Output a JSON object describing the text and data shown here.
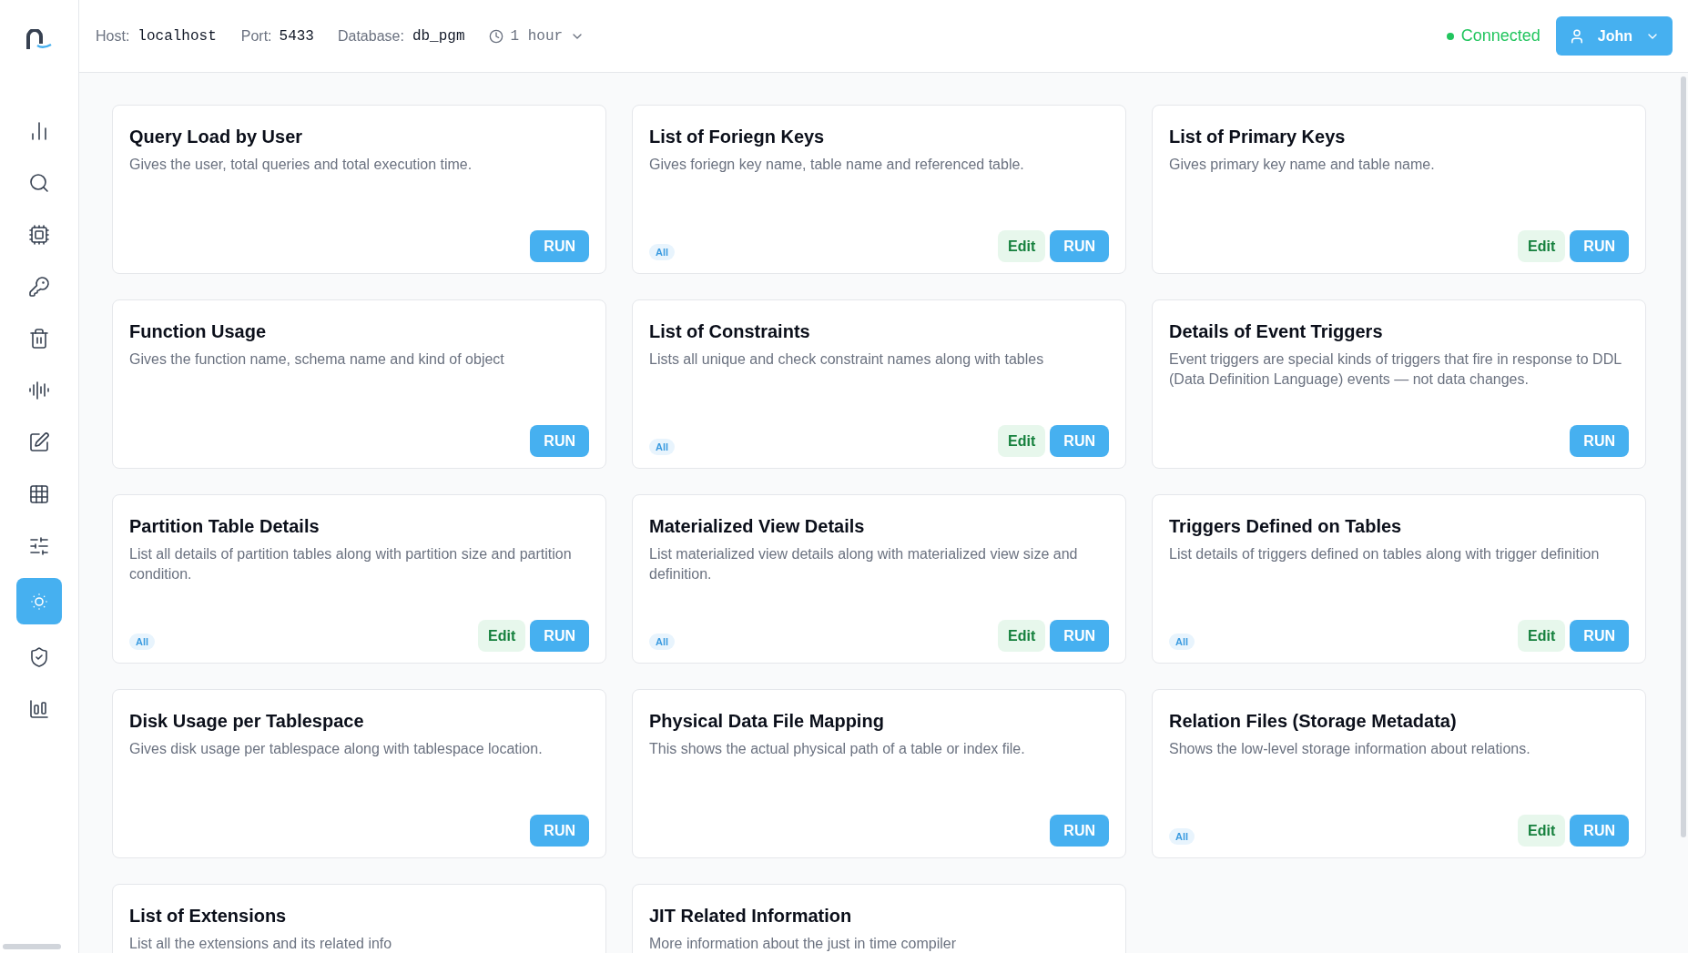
{
  "header": {
    "host_label": "Host:",
    "host": "localhost",
    "port_label": "Port:",
    "port": "5433",
    "database_label": "Database:",
    "database": "db_pgm",
    "time_range": "1 hour",
    "status": "Connected",
    "user": "John"
  },
  "sidebar": {
    "items": [
      {
        "selected": false
      },
      {
        "selected": false
      },
      {
        "selected": false
      },
      {
        "selected": false
      },
      {
        "selected": false
      },
      {
        "selected": false
      },
      {
        "selected": false
      },
      {
        "selected": false
      },
      {
        "selected": false
      },
      {
        "selected": true
      },
      {
        "selected": false
      },
      {
        "selected": false
      }
    ]
  },
  "cards": [
    {
      "title": "Query Load by User",
      "description": "Gives the user, total queries and total execution time.",
      "buttons": [
        "RUN"
      ]
    },
    {
      "title": "List of Foriegn Keys",
      "description": "Gives foriegn key name, table name and referenced table.",
      "tag": "All",
      "buttons": [
        "Edit",
        "RUN"
      ]
    },
    {
      "title": "List of Primary Keys",
      "description": "Gives primary key name and table name.",
      "buttons": [
        "Edit",
        "RUN"
      ]
    },
    {
      "title": "Function Usage",
      "description": "Gives the function name, schema name and kind of object",
      "buttons": [
        "RUN"
      ]
    },
    {
      "title": "List of Constraints",
      "description": "Lists all unique and check constraint names along with tables",
      "tag": "All",
      "buttons": [
        "Edit",
        "RUN"
      ]
    },
    {
      "title": "Details of Event Triggers",
      "description": "Event triggers are special kinds of triggers that fire in response to DDL (Data Definition Language) events — not data changes.",
      "buttons": [
        "RUN"
      ]
    },
    {
      "title": "Partition Table Details",
      "description": "List all details of partition tables along with partition size and partition condition.",
      "tag": "All",
      "buttons": [
        "Edit",
        "RUN"
      ]
    },
    {
      "title": "Materialized View Details",
      "description": "List materialized view details along with materialized view size and definition.",
      "tag": "All",
      "buttons": [
        "Edit",
        "RUN"
      ]
    },
    {
      "title": "Triggers Defined on Tables",
      "description": "List details of triggers defined on tables along with trigger definition",
      "tag": "All",
      "buttons": [
        "Edit",
        "RUN"
      ]
    },
    {
      "title": "Disk Usage per Tablespace",
      "description": "Gives disk usage per tablespace along with tablespace location.",
      "buttons": [
        "RUN"
      ]
    },
    {
      "title": "Physical Data File Mapping",
      "description": "This shows the actual physical path of a table or index file.",
      "buttons": [
        "RUN"
      ]
    },
    {
      "title": "Relation Files (Storage Metadata)",
      "description": "Shows the low-level storage information about relations.",
      "tag": "All",
      "buttons": [
        "Edit",
        "RUN"
      ]
    },
    {
      "title": "List of Extensions",
      "description": "List all the extensions and its related info"
    },
    {
      "title": "JIT Related Information",
      "description": "More information about the just in time compiler"
    }
  ]
}
